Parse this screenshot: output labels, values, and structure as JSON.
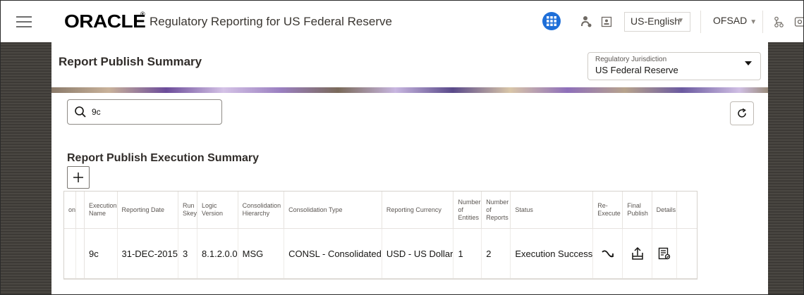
{
  "header": {
    "logo_text": "ORACLE",
    "logo_mark": "®",
    "app_title": "Regulatory Reporting for US Federal Reserve",
    "language": "US-English",
    "user": "OFSAD"
  },
  "icons": {
    "menu": "hamburger-menu-icon",
    "apps": "apps-grid-icon",
    "person": "user-icon",
    "contact": "contact-card-icon",
    "org": "org-chart-icon",
    "edge": "clipped-icon",
    "search": "search-icon",
    "refresh": "refresh-icon",
    "add": "plus-icon",
    "reexecute": "reexecute-icon",
    "publish": "upload-icon",
    "details": "details-report-icon"
  },
  "colors": {
    "accent": "#1f6fd8",
    "page_bg": "#3d3a36"
  },
  "page": {
    "title": "Report Publish Summary"
  },
  "jurisdiction": {
    "label": "Regulatory Jurisdiction",
    "value": "US Federal Reserve"
  },
  "search": {
    "value": "9c"
  },
  "section": {
    "title": "Report Publish Execution Summary"
  },
  "table": {
    "clipped_header": "on",
    "headers": {
      "execution_name": "Execution\nName",
      "reporting_date": "Reporting Date",
      "run_skey": "Run\nSkey",
      "logic_version": "Logic\nVersion",
      "consolidation_hierarchy": "Consolidation\nHierarchy",
      "consolidation_type": "Consolidation Type",
      "reporting_currency": "Reporting Currency",
      "number_of_entities": "Number\nof\nEntities",
      "number_of_reports": "Number\nof\nReports",
      "status": "Status",
      "reexecute": "Re-\nExecute",
      "final_publish": "Final\nPublish",
      "details": "Details"
    },
    "rows": [
      {
        "execution_name": "9c",
        "reporting_date": "31-DEC-2015",
        "run_skey": "3",
        "logic_version": "8.1.2.0.0",
        "consolidation_hierarchy": "MSG",
        "consolidation_type": "CONSL - Consolidated",
        "reporting_currency": "USD - US Dollar",
        "number_of_entities": "1",
        "number_of_reports": "2",
        "status": "Execution Success"
      }
    ]
  }
}
